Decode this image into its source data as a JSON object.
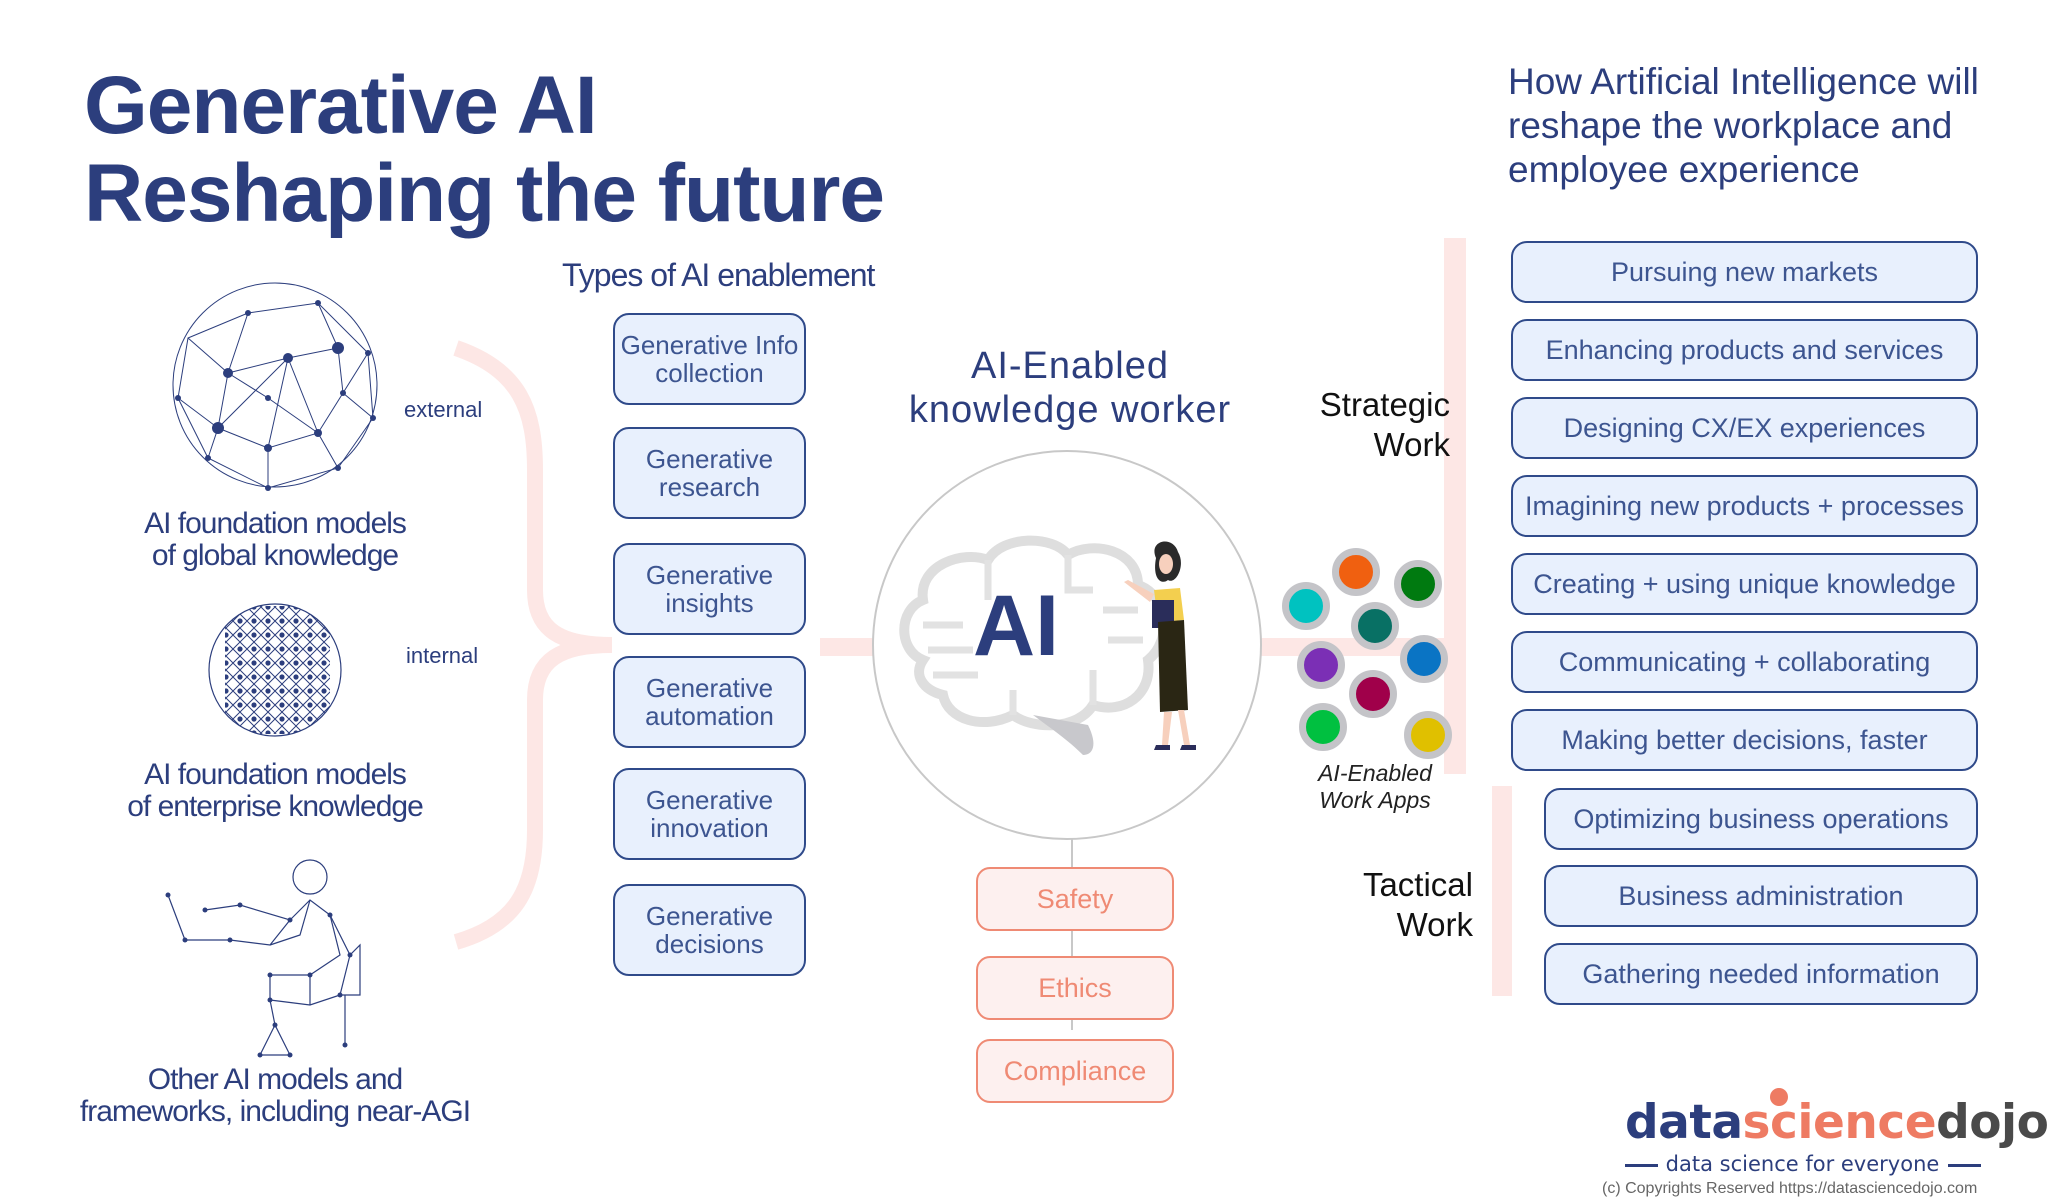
{
  "title": {
    "line1": "Generative AI",
    "line2": "Reshaping the future"
  },
  "right_heading": {
    "line1": "How Artificial Intelligence will",
    "line2": "reshape the workplace and",
    "line3": "employee experience"
  },
  "sources": [
    {
      "icon": "network-globe-icon",
      "label_line1": "AI foundation models",
      "label_line2": "of global knowledge",
      "side_label": "external"
    },
    {
      "icon": "mesh-globe-icon",
      "label_line1": "AI foundation models",
      "label_line2": "of enterprise knowledge",
      "side_label": "internal"
    },
    {
      "icon": "wireframe-human-laptop-icon",
      "label_line1": "Other AI models and",
      "label_line2": "frameworks, including near-AGI"
    }
  ],
  "enablement": {
    "heading": "Types of AI enablement",
    "items": [
      {
        "line1": "Generative Info",
        "line2": "collection"
      },
      {
        "line1": "Generative",
        "line2": "research"
      },
      {
        "line1": "Generative",
        "line2": "insights"
      },
      {
        "line1": "Generative",
        "line2": "automation"
      },
      {
        "line1": "Generative",
        "line2": "innovation"
      },
      {
        "line1": "Generative",
        "line2": "decisions"
      }
    ]
  },
  "worker": {
    "title_line1": "AI-Enabled",
    "title_line2": "knowledge worker",
    "brain_text": "AI",
    "governance": [
      "Safety",
      "Ethics",
      "Compliance"
    ]
  },
  "work_apps": {
    "label_line1": "AI-Enabled",
    "label_line2": "Work Apps",
    "dot_colors": [
      "#00c2c0",
      "#f06010",
      "#007a10",
      "#087064",
      "#7b2fb5",
      "#0a74c4",
      "#a0004a",
      "#00c040",
      "#e0c000"
    ]
  },
  "strategic": {
    "label_line1": "Strategic",
    "label_line2": "Work",
    "items": [
      "Pursuing new markets",
      "Enhancing products and services",
      "Designing CX/EX experiences",
      "Imagining new products + processes",
      "Creating + using unique knowledge",
      "Communicating + collaborating",
      "Making better decisions, faster"
    ]
  },
  "tactical": {
    "label_line1": "Tactical",
    "label_line2": "Work",
    "items": [
      "Optimizing business operations",
      "Business administration",
      "Gathering needed information"
    ]
  },
  "branding": {
    "logo_part1": "data",
    "logo_part2": "science",
    "logo_part3": "dojo",
    "tagline": "data science for everyone",
    "copyright": "(c) Copyrights Reserved  https://datasciencedojo.com"
  },
  "colors": {
    "navy": "#2c3e7d",
    "box_fill": "#e8f0fd",
    "salmon": "#ef8a74",
    "pink_connector": "#fde7e5",
    "logo_gray": "#4a4a4a"
  }
}
